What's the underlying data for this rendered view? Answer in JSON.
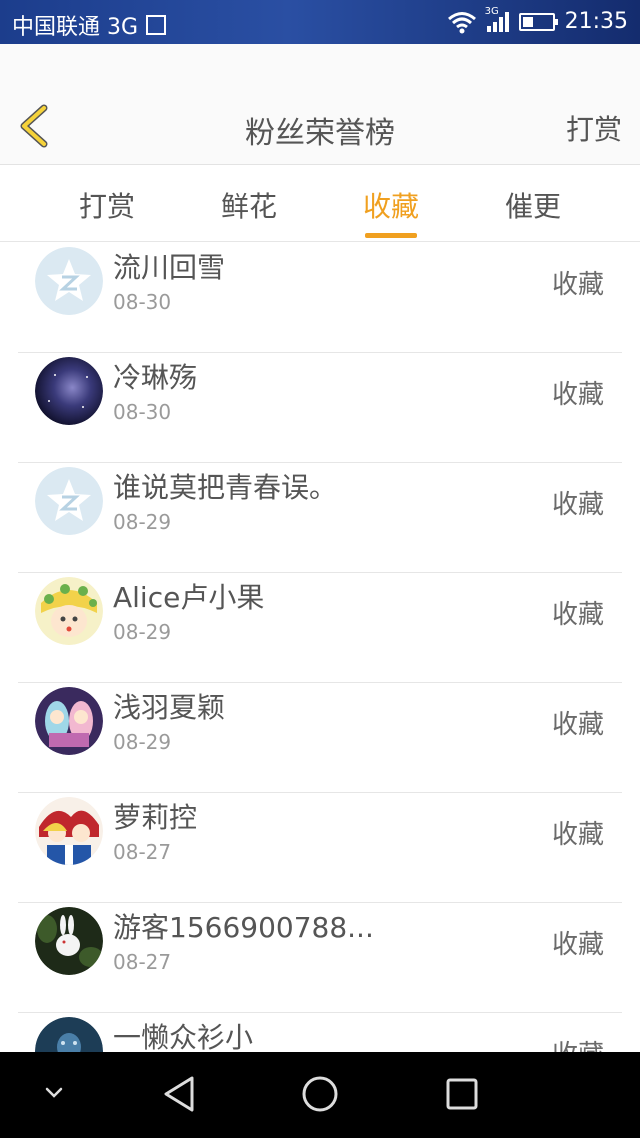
{
  "status_bar": {
    "carrier": "中国联通 3G",
    "network": "3G",
    "time": "21:35",
    "battery_level": 0.35
  },
  "header": {
    "title": "粉丝荣誉榜",
    "right_action": "打赏"
  },
  "tabs": [
    {
      "label": "打赏",
      "active": false
    },
    {
      "label": "鲜花",
      "active": false
    },
    {
      "label": "收藏",
      "active": true
    },
    {
      "label": "催更",
      "active": false
    }
  ],
  "list": [
    {
      "name": "流川回雪",
      "date": "08-30",
      "action": "收藏",
      "avatar": "qq-default"
    },
    {
      "name": "冷琳殇",
      "date": "08-30",
      "action": "收藏",
      "avatar": "galaxy"
    },
    {
      "name": "谁说莫把青春误。",
      "date": "08-29",
      "action": "收藏",
      "avatar": "qq-default"
    },
    {
      "name": "Alice卢小果",
      "date": "08-29",
      "action": "收藏",
      "avatar": "anime-blonde"
    },
    {
      "name": "浅羽夏颖",
      "date": "08-29",
      "action": "收藏",
      "avatar": "anime-pair"
    },
    {
      "name": "萝莉控",
      "date": "08-27",
      "action": "收藏",
      "avatar": "anime-red"
    },
    {
      "name": "游客1566900788...",
      "date": "08-27",
      "action": "收藏",
      "avatar": "rabbit"
    },
    {
      "name": "一懒众衫小",
      "date": "",
      "action": "收藏",
      "avatar": "blue-dark"
    }
  ],
  "colors": {
    "accent": "#f0a020",
    "status_bar": "#1c3d8c",
    "back_arrow": "#f5d23a"
  },
  "nav": {
    "icons": [
      "chevron-down-icon",
      "back-triangle-icon",
      "home-circle-icon",
      "recents-square-icon"
    ]
  }
}
